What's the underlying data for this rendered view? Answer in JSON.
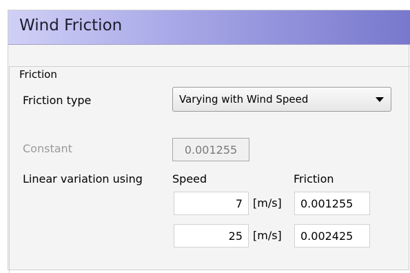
{
  "header": {
    "title": "Wind Friction"
  },
  "group": {
    "legend": "Friction"
  },
  "friction_type": {
    "label": "Friction type",
    "selected": "Varying with Wind Speed"
  },
  "constant": {
    "label": "Constant",
    "value": "0.001255"
  },
  "linear": {
    "label": "Linear variation using",
    "speed_header": "Speed",
    "friction_header": "Friction",
    "rows": [
      {
        "speed": "7",
        "unit": "[m/s]",
        "friction": "0.001255"
      },
      {
        "speed": "25",
        "unit": "[m/s]",
        "friction": "0.002425"
      }
    ]
  },
  "colors": {
    "header_gradient_start": "#d0d0f6",
    "header_gradient_end": "#7878cd",
    "panel_bg": "#f4f4f4",
    "disabled_text": "#9a9a9a"
  },
  "icons": {
    "dropdown": "chevron-down-icon"
  }
}
